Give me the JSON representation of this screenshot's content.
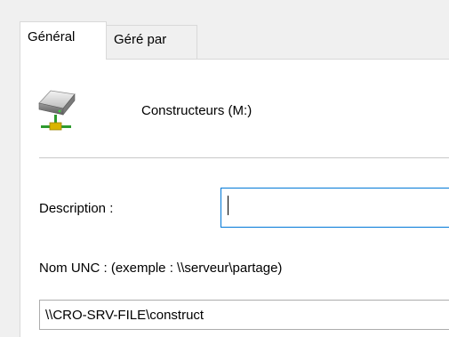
{
  "tabs": [
    {
      "label": "Général",
      "active": true
    },
    {
      "label": "Géré par",
      "active": false
    }
  ],
  "drive": {
    "icon": "network-drive-icon",
    "name": "Constructeurs (M:)"
  },
  "description": {
    "label": "Description :",
    "value": ""
  },
  "unc": {
    "label": "Nom UNC : (exemple : \\\\serveur\\partage)",
    "value": "\\\\CRO-SRV-FILE\\construct"
  },
  "colors": {
    "focus_border": "#0078d7",
    "connector_yellow": "#d9b400",
    "connector_green": "#2e9b2e"
  }
}
